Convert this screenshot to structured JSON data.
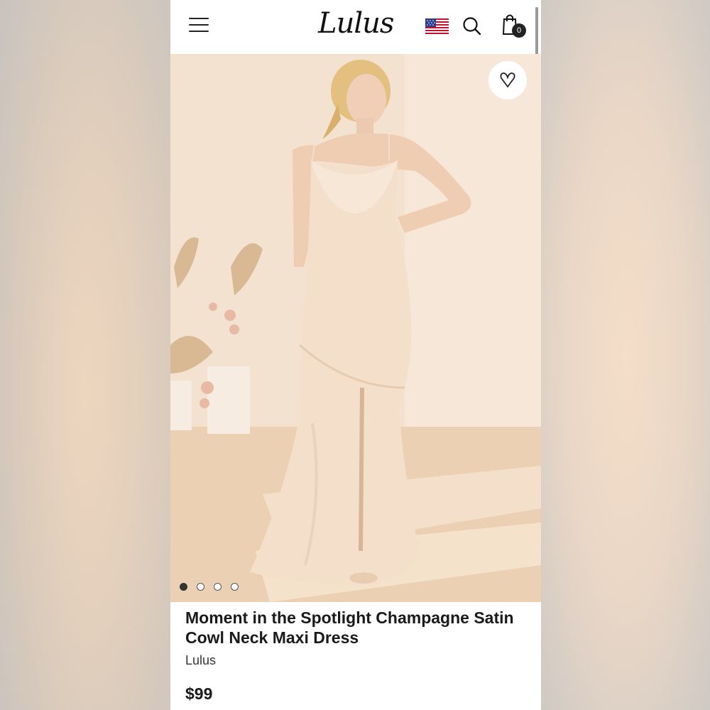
{
  "header": {
    "logo_text": "Lulus",
    "cart_count": "0",
    "menu_icon": "hamburger-icon",
    "search_icon": "search-icon",
    "cart_icon": "shopping-bag-icon",
    "flag_icon": "us-flag-icon"
  },
  "gallery": {
    "image_count": 4,
    "active_index": 0,
    "favorite_icon": "heart-icon"
  },
  "product": {
    "title": "Moment in the Spotlight Champagne Satin Cowl Neck Maxi Dress",
    "brand": "Lulus",
    "price": "$99"
  },
  "colors": {
    "dress": "#f4dfca",
    "background": "#f3dfcb",
    "floor": "#e9c9aa",
    "text": "#1a1a1a"
  }
}
